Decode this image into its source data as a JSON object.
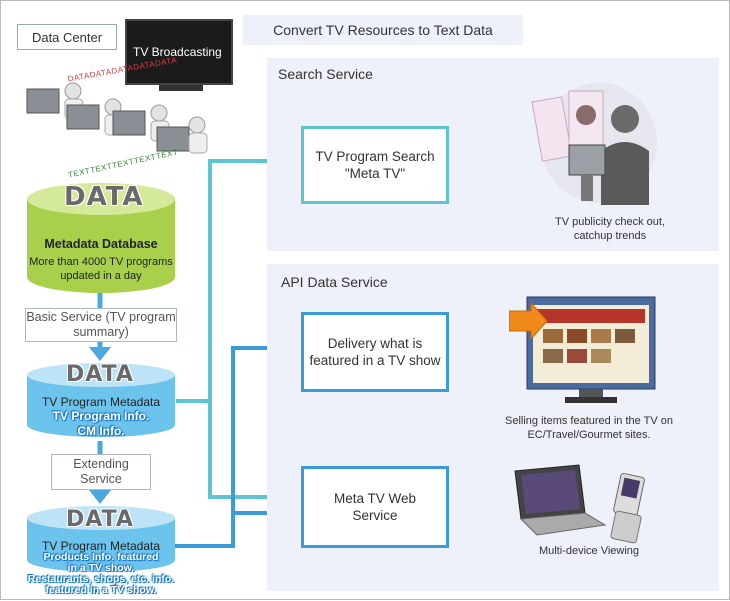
{
  "header": {
    "convert_title": "Convert TV Resources  to Text Data"
  },
  "left": {
    "data_center_label": "Data Center",
    "tv_broadcasting_label": "TV Broadcasting",
    "data_stream_text": "DATADATADATADATADATA",
    "text_stream_text": "TEXTTEXTTEXTTEXTTEXT",
    "main_db": {
      "data_word": "DATA",
      "title": "Metadata Database",
      "desc": "More than 4000 TV programs updated in a day"
    },
    "basic_service": "Basic Service (TV program summary)",
    "db2": {
      "data_word": "DATA",
      "title": "TV Program Metadata",
      "highlight_1": "TV Program Info.",
      "highlight_2": "CM Info."
    },
    "extending_service": "Extending Service",
    "db3": {
      "data_word": "DATA",
      "title": "TV Program Metadata",
      "highlight_1": "Products Info. featured",
      "highlight_2": "in a TV show.",
      "highlight_3": "Restaurants, shops, etc. info.",
      "highlight_4": "featured in a TV show."
    }
  },
  "search_panel": {
    "title": "Search Service",
    "service_line1": "TV Program Search",
    "service_line2": "\"Meta TV\"",
    "caption_line1": "TV publicity check out,",
    "caption_line2": "catchup trends"
  },
  "api_panel": {
    "title": "API Data Service",
    "delivery_line1": "Delivery what is",
    "delivery_line2": "featured in a TV show",
    "delivery_caption_line1": "Selling items featured in the TV on",
    "delivery_caption_line2": "EC/Travel/Gourmet sites.",
    "web_line1": "Meta TV Web",
    "web_line2": "Service",
    "web_caption": "Multi-device Viewing"
  },
  "colors": {
    "teal": "#5ec4cf",
    "blue": "#3b9bd8",
    "green": "#9cc93a",
    "panel": "#eef0fa"
  }
}
